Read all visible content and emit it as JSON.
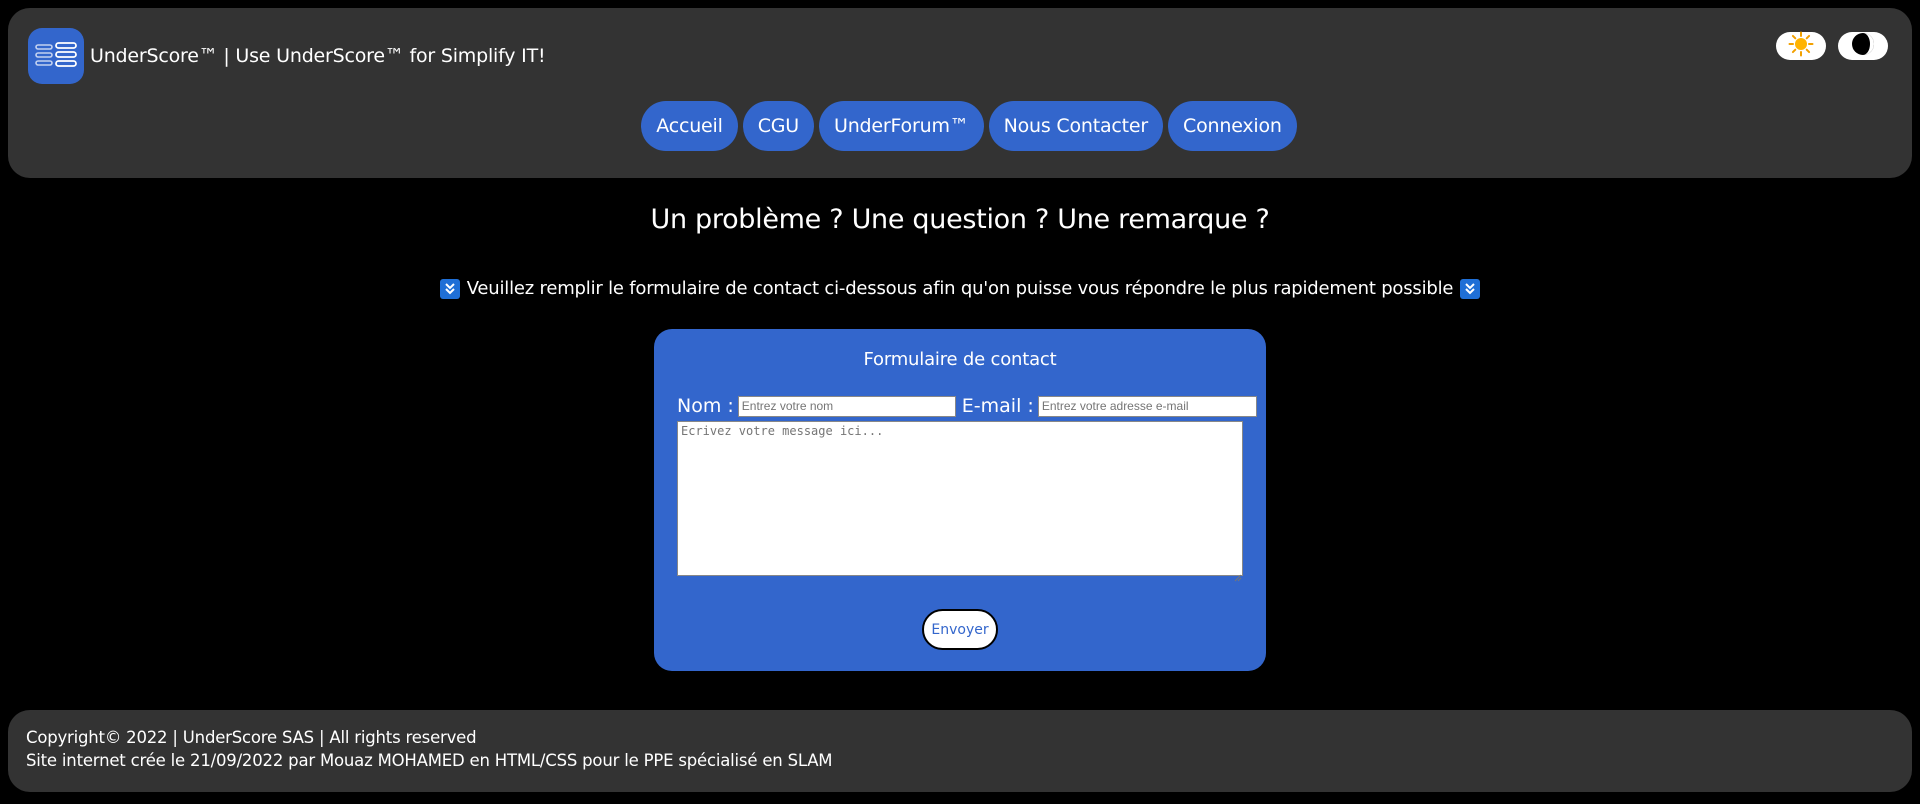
{
  "header": {
    "site_title": "UnderScore™ | Use UnderScore™ for Simplify IT!",
    "logo_icon": "stacked-list-logo",
    "theme_toggles": [
      {
        "name": "light-mode",
        "icon": "sun-icon"
      },
      {
        "name": "dark-mode",
        "icon": "moon-icon"
      }
    ]
  },
  "nav": {
    "items": [
      "Accueil",
      "CGU",
      "UnderForum™",
      "Nous Contacter",
      "Connexion"
    ]
  },
  "main": {
    "heading": "Un problème ? Une question ? Une remarque ?",
    "instructions": "Veuillez remplir le formulaire de contact ci-dessous afin qu'on puisse vous répondre le plus rapidement possible",
    "instructions_icon": "double-down-arrow-icon"
  },
  "form": {
    "title": "Formulaire de contact",
    "name_label": "Nom :",
    "name_placeholder": "Entrez votre nom",
    "email_label": "E-mail :",
    "email_placeholder": "Entrez votre adresse e-mail",
    "message_placeholder": "Ecrivez votre message ici...",
    "submit_label": "Envoyer"
  },
  "footer": {
    "line1": "Copyright© 2022 | UnderScore SAS | All rights reserved",
    "line2": "Site internet crée le 21/09/2022 par Mouaz MOHAMED en HTML/CSS pour le PPE spécialisé en SLAM"
  },
  "colors": {
    "accent": "#3366cc",
    "panel": "#333333",
    "background": "#000000"
  }
}
